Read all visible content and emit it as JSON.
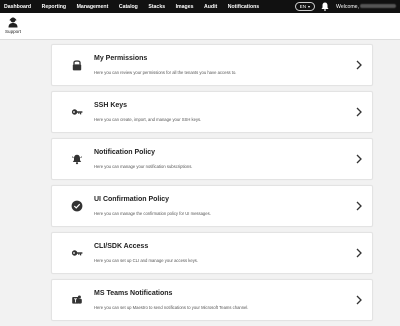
{
  "nav": {
    "items": [
      {
        "label": "Dashboard"
      },
      {
        "label": "Reporting"
      },
      {
        "label": "Management"
      },
      {
        "label": "Catalog"
      },
      {
        "label": "Stacks"
      },
      {
        "label": "Images"
      },
      {
        "label": "Audit"
      },
      {
        "label": "Notifications"
      }
    ],
    "language": "EN",
    "welcome": "Welcome,"
  },
  "subbar": {
    "support_label": "Support"
  },
  "cards": [
    {
      "title": "My Permissions",
      "description": "Here you can review your permissions for all the tenants you have access to.",
      "icon": "lock-icon"
    },
    {
      "title": "SSH Keys",
      "description": "Here you can create, import, and manage your SSH keys.",
      "icon": "key-icon"
    },
    {
      "title": "Notification Policy",
      "description": "Here you can manage your notification subscriptions.",
      "icon": "bell-ring-icon"
    },
    {
      "title": "UI Confirmation Policy",
      "description": "Here you can manage the confirmation policy for UI messages.",
      "icon": "check-circle-icon"
    },
    {
      "title": "CLI/SDK Access",
      "description": "Here you can set up CLI and manage your access keys.",
      "icon": "key-icon"
    },
    {
      "title": "MS Teams Notifications",
      "description": "Here you can set up Maestro to send notifications to your Microsoft Teams channel.",
      "icon": "teams-icon"
    }
  ]
}
